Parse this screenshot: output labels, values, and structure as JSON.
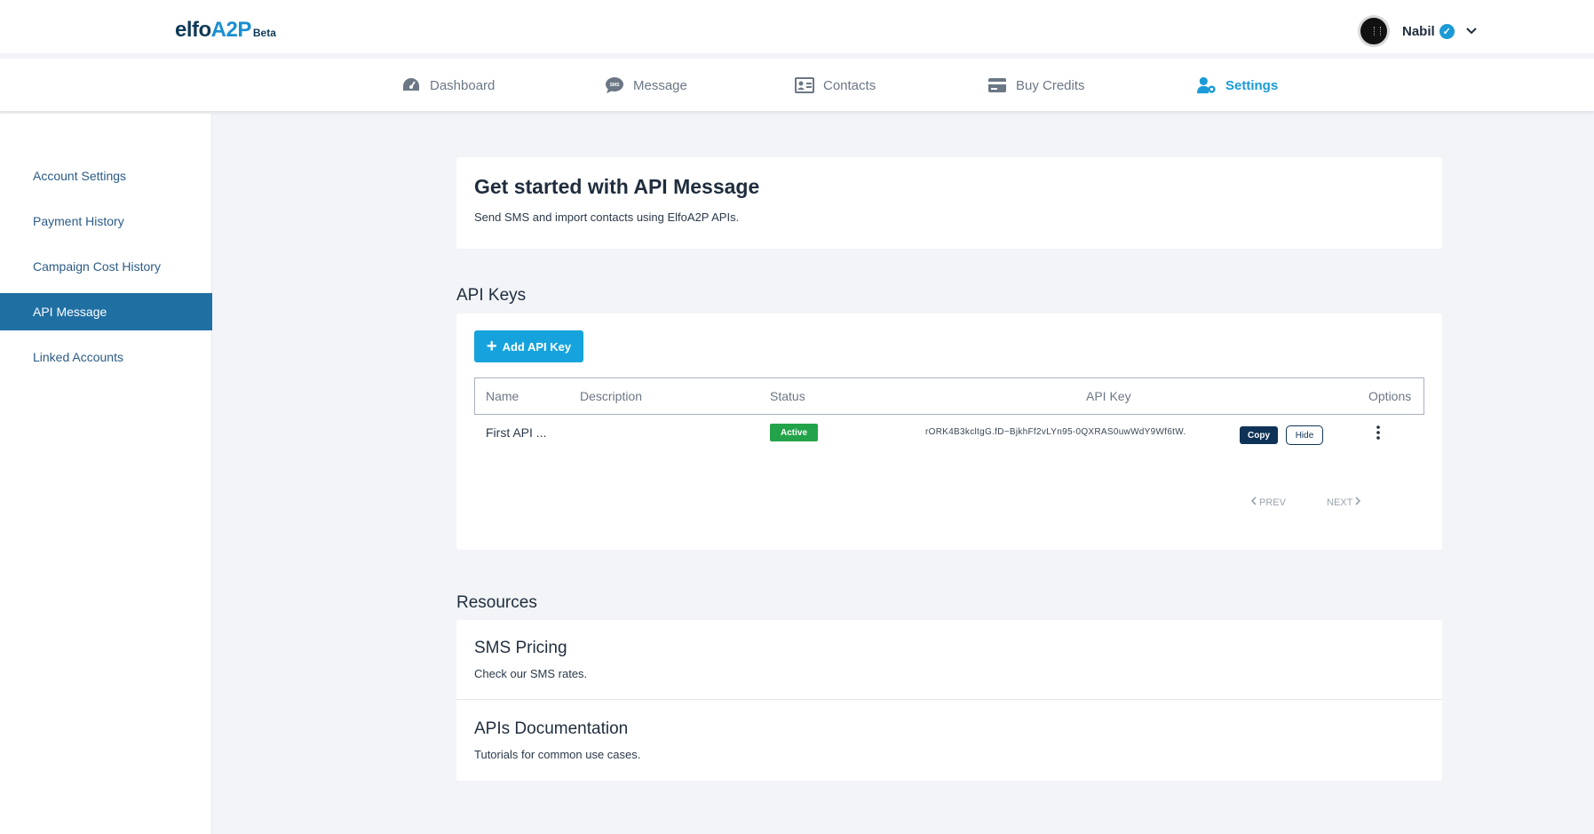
{
  "brand": {
    "logo_main": "elfo",
    "logo_accent": "A2P",
    "logo_badge": "Beta"
  },
  "user": {
    "name": "Nabil",
    "verified_icon": "check-badge-icon",
    "menu_icon": "chevron-down-icon"
  },
  "nav": {
    "items": [
      {
        "label": "Dashboard",
        "icon": "speedometer-icon"
      },
      {
        "label": "Message",
        "icon": "sms-bubble-icon"
      },
      {
        "label": "Contacts",
        "icon": "contact-card-icon"
      },
      {
        "label": "Buy Credits",
        "icon": "credit-card-icon"
      },
      {
        "label": "Settings",
        "icon": "user-gear-icon"
      }
    ],
    "active": "Settings"
  },
  "sidebar": {
    "items": [
      {
        "label": "Account Settings"
      },
      {
        "label": "Payment History"
      },
      {
        "label": "Campaign Cost History"
      },
      {
        "label": "API Message"
      },
      {
        "label": "Linked Accounts"
      }
    ],
    "active": "API Message"
  },
  "intro": {
    "title": "Get started with API Message",
    "subtitle": "Send SMS and import contacts using ElfoA2P APIs."
  },
  "api_keys": {
    "section_title": "API Keys",
    "add_button": "Add API Key",
    "columns": [
      "Name",
      "Description",
      "Status",
      "API Key",
      "Options"
    ],
    "rows": [
      {
        "name": "First API ...",
        "description": "",
        "status": "Active",
        "api_key": "rORK4B3kcltgG.fD~BjkhFf2vLYn95-0QXRAS0uwWdY9Wf6tW.",
        "copy_label": "Copy",
        "hide_label": "Hide"
      }
    ],
    "pagination": {
      "prev": "PREV",
      "next": "NEXT"
    }
  },
  "resources": {
    "section_title": "Resources",
    "items": [
      {
        "title": "SMS Pricing",
        "subtitle": "Check our SMS rates."
      },
      {
        "title": "APIs Documentation",
        "subtitle": "Tutorials for common use cases."
      }
    ]
  },
  "colors": {
    "accent": "#1a9bd7",
    "sidebar_active": "#1f6fa3",
    "status_active": "#22a34a",
    "copy_button": "#0f3357"
  }
}
